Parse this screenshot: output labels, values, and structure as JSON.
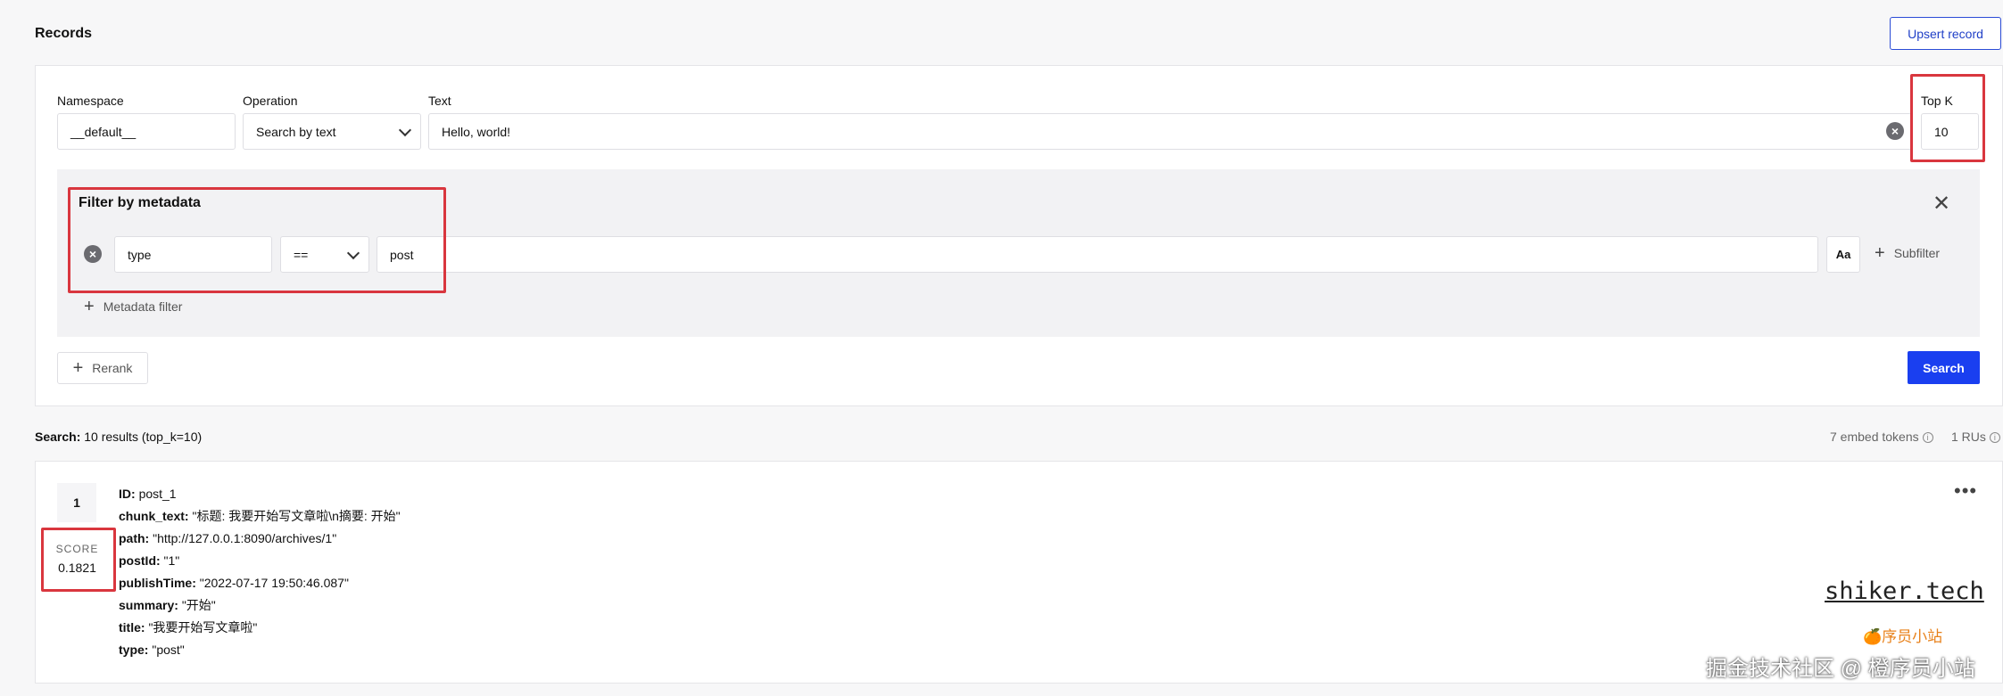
{
  "header": {
    "title": "Records",
    "upsert_label": "Upsert record"
  },
  "query": {
    "namespace": {
      "label": "Namespace",
      "value": "__default__"
    },
    "operation": {
      "label": "Operation",
      "value": "Search by text"
    },
    "text": {
      "label": "Text",
      "value": "Hello, world!"
    },
    "top_k": {
      "label": "Top K",
      "value": "10"
    }
  },
  "filter": {
    "title": "Filter by metadata",
    "field": "type",
    "operator": "==",
    "value": "post",
    "case_label": "Aa",
    "subfilter_label": "Subfilter",
    "add_filter_label": "Metadata filter"
  },
  "actions": {
    "rerank_label": "Rerank",
    "search_label": "Search"
  },
  "summary": {
    "prefix": "Search:",
    "text": "10 results (top_k=10)",
    "embed_tokens": "7 embed tokens",
    "rus": "1 RUs"
  },
  "result": {
    "rank": "1",
    "score_label": "SCORE",
    "score": "0.1821",
    "fields": [
      {
        "key": "ID:",
        "value": "post_1"
      },
      {
        "key": "chunk_text:",
        "value": "\"标题: 我要开始写文章啦\\n摘要: 开始\""
      },
      {
        "key": "path:",
        "value": "\"http://127.0.0.1:8090/archives/1\""
      },
      {
        "key": "postId:",
        "value": "\"1\""
      },
      {
        "key": "publishTime:",
        "value": "\"2022-07-17 19:50:46.087\""
      },
      {
        "key": "summary:",
        "value": "\"开始\""
      },
      {
        "key": "title:",
        "value": "\"我要开始写文章啦\""
      },
      {
        "key": "type:",
        "value": "\"post\""
      }
    ]
  },
  "watermarks": {
    "site": "shiker.tech",
    "orange": "🍊序员小站",
    "juejin": "掘金技术社区 @ 橙序员小站"
  },
  "colors": {
    "accent": "#1a3ff0",
    "highlight": "#d9363e"
  }
}
